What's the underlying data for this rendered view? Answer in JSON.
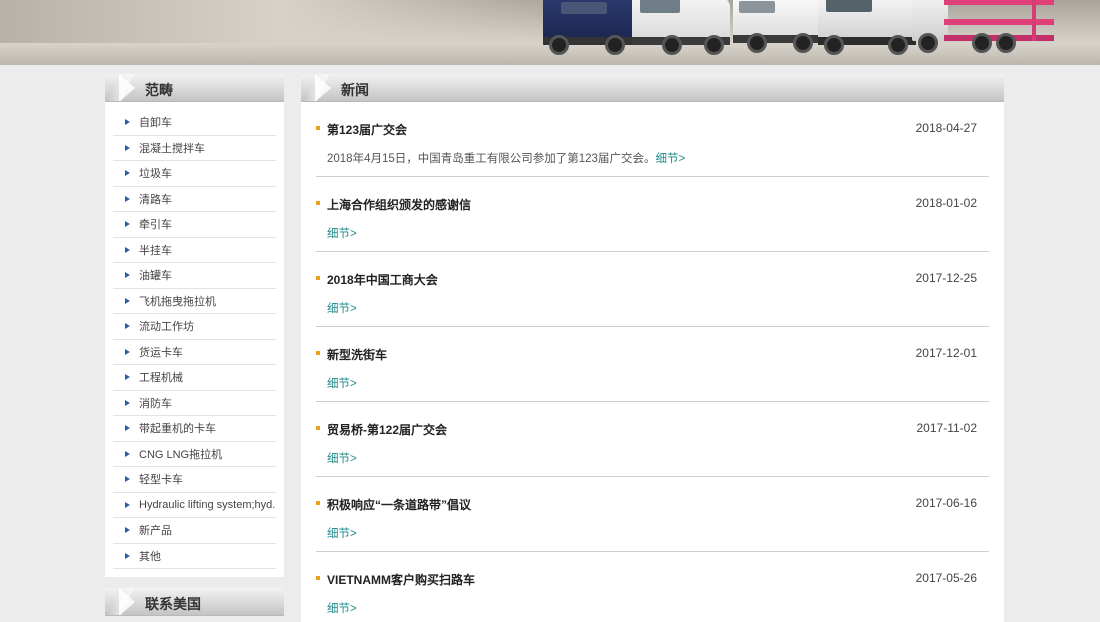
{
  "sidebar": {
    "title": "范畴",
    "items": [
      {
        "label": "自卸车"
      },
      {
        "label": "混凝土搅拌车"
      },
      {
        "label": "垃圾车"
      },
      {
        "label": "清路车"
      },
      {
        "label": "牵引车"
      },
      {
        "label": "半挂车"
      },
      {
        "label": "油罐车"
      },
      {
        "label": "飞机拖曳拖拉机"
      },
      {
        "label": "流动工作坊"
      },
      {
        "label": "货运卡车"
      },
      {
        "label": "工程机械"
      },
      {
        "label": "消防车"
      },
      {
        "label": "带起重机的卡车"
      },
      {
        "label": "CNG LNG拖拉机"
      },
      {
        "label": "轻型卡车"
      },
      {
        "label": "Hydraulic lifting system;hyd..."
      },
      {
        "label": "新产品"
      },
      {
        "label": "其他"
      }
    ]
  },
  "contact": {
    "title": "联系美国"
  },
  "news": {
    "title": "新闻",
    "items": [
      {
        "title": "第123届广交会",
        "date": "2018-04-27",
        "summary": "2018年4月15日，中国青岛重工有限公司参加了第123届广交会。",
        "more": "细节>"
      },
      {
        "title": "上海合作组织颁发的感谢信",
        "date": "2018-01-02",
        "summary": "",
        "more": "细节>"
      },
      {
        "title": "2018年中国工商大会",
        "date": "2017-12-25",
        "summary": "",
        "more": "细节>"
      },
      {
        "title": "新型洗街车",
        "date": "2017-12-01",
        "summary": "",
        "more": "细节>"
      },
      {
        "title": "贸易桥-第122届广交会",
        "date": "2017-11-02",
        "summary": "",
        "more": "细节>"
      },
      {
        "title": "积极响应“一条道路带”倡议",
        "date": "2017-06-16",
        "summary": "",
        "more": "细节>"
      },
      {
        "title": "VIETNAMM客户购买扫路车",
        "date": "2017-05-26",
        "summary": "",
        "more": "细节>"
      }
    ]
  },
  "colors": {
    "page_bg": "#ececec",
    "bullet_blue": "#2a5fa8",
    "news_dot": "#e8a21b",
    "link_teal": "#1f8a8a"
  }
}
